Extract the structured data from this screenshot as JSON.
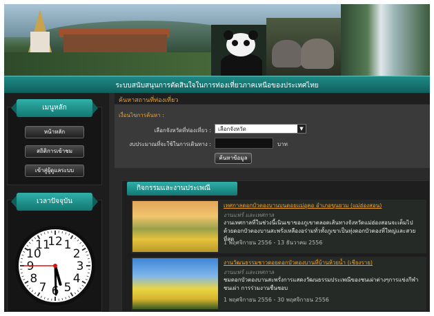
{
  "site": {
    "title": "ระบบสนับสนุนการตัดสินใจในการท่องเที่ยวภาคเหนือของประเทศไทย"
  },
  "sidebar": {
    "menu_heading": "เมนูหลัก",
    "menu_items": [
      {
        "label": "หน้าหลัก"
      },
      {
        "label": "สถิติการเข้าชม"
      },
      {
        "label": "เข้าสู่ผู้ดูแลระบบ"
      }
    ],
    "clock_heading": "เวลาปัจจุบัน",
    "clock": {
      "hour": 5,
      "minute": 29,
      "second": 45
    }
  },
  "search": {
    "heading": "ค้นหาสถานที่ท่องเที่ยว",
    "legend": "เงื่อนไขการค้นหา :",
    "province_label": "เลือกจังหวัดที่ท่องเที่ยว :",
    "province_value": "เลือกจังหวัด",
    "budget_label": "งบประมาณที่จะใช้ในการเดินทาง :",
    "budget_value": "",
    "budget_unit": "บาท",
    "search_button": "ค้นหาข้อมูล"
  },
  "activities": {
    "heading": "กิจกรรมและงานประเพณี",
    "items": [
      {
        "title": "เทศกาลดอกบัวตองบานบนดอยแม่อูคอ อำเภอขุนยวม (แม่ฮ่องสอน)",
        "category": "งานแฟร์ และเทศกาล",
        "desc": "งานเทศกาลที่ในช่วงนี้เนินเขาของภูเขาตลอดเส้นทางจังหวัดแม่ฮ่องสอนจะเต็มไปด้วยดอกบัวตองบานสะพรั่งเหลืองอร่ามทั่วทั้งภูเขาเป็นทุ่งดอกบัวตองที่ใหญ่และสวยที่สุด",
        "date": "1 พฤศจิกายน 2556 - 13 ธันวาคม 2556"
      },
      {
        "title": "งานวัฒนธรรมชาวดอยดอกบัวตองบานที่บ้านห้วยน้ำ (เชียงราย)",
        "category": "งานแฟร์ และเทศกาล",
        "desc": "ชมดอกบัวตองบานสะพรั่งการแสดงวัฒนธรรมประเพณีของชนเผ่าต่างๆการแข่งกีฬาชนเผ่า การร่วมงานชื่นชอบ",
        "date": "1 พฤศจิกายน 2556 - 30 พฤศจิกายน 2556"
      }
    ]
  }
}
